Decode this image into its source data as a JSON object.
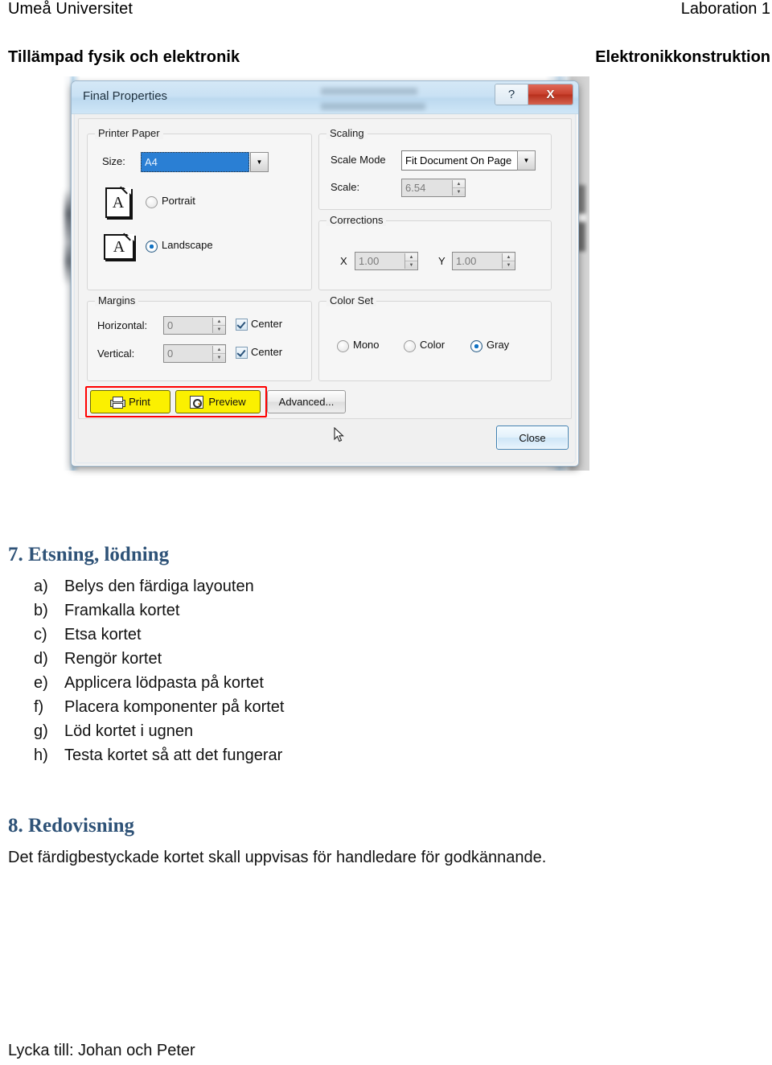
{
  "header": {
    "left_line1": "Umeå Universitet",
    "left_line2": "Tillämpad fysik och elektronik",
    "right_line1": "Laboration 1",
    "right_line2": "Elektronikkonstruktion"
  },
  "dialog": {
    "title": "Final Properties",
    "help_button": "?",
    "close_x_button": "X",
    "groups": {
      "printer_paper": {
        "legend": "Printer Paper",
        "size_label": "Size:",
        "size_value": "A4",
        "orientation": [
          {
            "label": "Portrait",
            "selected": false,
            "icon": "portrait-page-icon",
            "glyph": "A"
          },
          {
            "label": "Landscape",
            "selected": true,
            "icon": "landscape-page-icon",
            "glyph": "A"
          }
        ]
      },
      "scaling": {
        "legend": "Scaling",
        "scale_mode_label": "Scale Mode",
        "scale_mode_value": "Fit Document On Page",
        "scale_label": "Scale:",
        "scale_value": "6.54"
      },
      "corrections": {
        "legend": "Corrections",
        "x_label": "X",
        "x_value": "1.00",
        "y_label": "Y",
        "y_value": "1.00"
      },
      "margins": {
        "legend": "Margins",
        "horizontal_label": "Horizontal:",
        "horizontal_value": "0",
        "horizontal_center_label": "Center",
        "horizontal_center_checked": true,
        "vertical_label": "Vertical:",
        "vertical_value": "0",
        "vertical_center_label": "Center",
        "vertical_center_checked": true
      },
      "color_set": {
        "legend": "Color Set",
        "options": [
          {
            "label": "Mono",
            "selected": false
          },
          {
            "label": "Color",
            "selected": false
          },
          {
            "label": "Gray",
            "selected": true
          }
        ]
      }
    },
    "actions": {
      "print": "Print",
      "preview": "Preview",
      "advanced": "Advanced...",
      "close": "Close"
    },
    "highlight_color": "#fbf000",
    "highlight_border_color": "#ff0000",
    "background_fragment_text": [
      "ns",
      "ns",
      "ns",
      "ns",
      "ns",
      "ns",
      "ns"
    ]
  },
  "content": {
    "section7": {
      "heading": "7. Etsning, lödning",
      "items": [
        {
          "marker": "a)",
          "text": "Belys den färdiga layouten"
        },
        {
          "marker": "b)",
          "text": "Framkalla kortet"
        },
        {
          "marker": "c)",
          "text": "Etsa kortet"
        },
        {
          "marker": "d)",
          "text": "Rengör kortet"
        },
        {
          "marker": "e)",
          "text": "Applicera lödpasta på kortet"
        },
        {
          "marker": "f)",
          "text": "Placera komponenter på kortet"
        },
        {
          "marker": "g)",
          "text": "Löd kortet i ugnen"
        },
        {
          "marker": "h)",
          "text": "Testa kortet så att det fungerar"
        }
      ]
    },
    "section8": {
      "heading": "8. Redovisning",
      "paragraph": "Det färdigbestyckade kortet skall uppvisas för handledare för godkännande."
    },
    "footer": "Lycka till: Johan och Peter"
  },
  "colors": {
    "heading": "#2e5277",
    "titlebar": "#c9e1f4",
    "selection": "#2a7fd4",
    "close_red": "#c9412e"
  }
}
